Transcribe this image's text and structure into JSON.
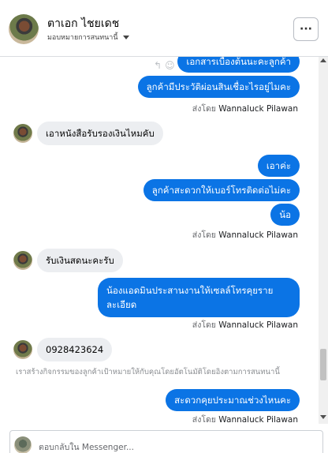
{
  "header": {
    "name": "ตาเอก ไชยเดช",
    "assign_label": "มอบหมายการสนทนานี้",
    "more_label": "···"
  },
  "thread": {
    "partial_top_message": "เอกสารเบื้องต้นนะคะลูกค้า",
    "sender_prefix": "ส่งโดย",
    "sender_name": "Wannaluck Pilawan",
    "messages": [
      {
        "id": "m1",
        "dir": "out",
        "text": "ลูกค้ามีประวัติผ่อนสินเชื่อะไรอยู่ไมคะ"
      },
      {
        "id": "m2",
        "dir": "in",
        "text": "เอาหนังสือรับรองเงินไหมคับ"
      },
      {
        "id": "m3",
        "dir": "out",
        "text": "เอาค่ะ"
      },
      {
        "id": "m4",
        "dir": "out",
        "text": "ลูกค้าสะดวกให้เบอร์โทรติดต่อไม่คะ"
      },
      {
        "id": "m5",
        "dir": "out",
        "text": "น้อ"
      },
      {
        "id": "m6",
        "dir": "in",
        "text": "รับเงินสดนะคะรับ"
      },
      {
        "id": "m7",
        "dir": "out",
        "line1": "น้องแอดมินประสานงานให้เซลล์โทรคุยราย",
        "line2": "ละเอียด"
      },
      {
        "id": "m8",
        "dir": "in",
        "text": "0928423624"
      },
      {
        "id": "m9",
        "dir": "out",
        "text": "สะดวกคุยประมาณช่วงไหนคะ"
      }
    ],
    "system_note": "เราสร้างกิจกรรมของลูกค้าเป้าหมายให้กับคุณโดยอัตโนมัติโดยอิงตามการสนทนานี้"
  },
  "composer": {
    "placeholder": "ตอบกลับใน Messenger..."
  },
  "icons": [
    "reply-icon",
    "emoji-icon",
    "chevron-down-icon",
    "more-icon",
    "scroll-up-icon",
    "scroll-down-icon"
  ],
  "colors": {
    "outgoing_bubble": "#0b74e5",
    "incoming_bubble": "#eceef1",
    "meta_text": "#65676b"
  }
}
